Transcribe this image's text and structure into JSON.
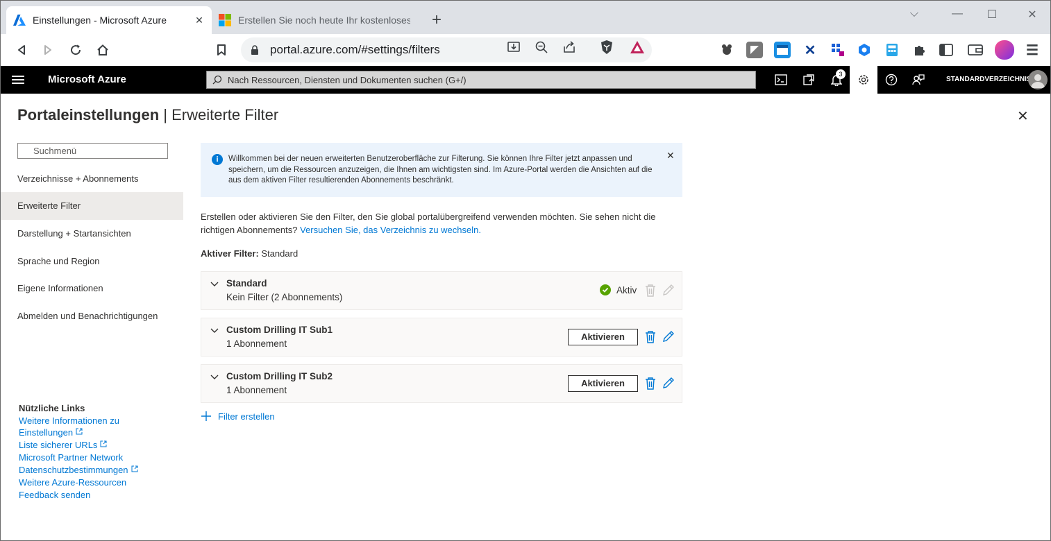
{
  "browser": {
    "tabs": [
      {
        "title": "Einstellungen - Microsoft Azure",
        "active": true
      },
      {
        "title": "Erstellen Sie noch heute Ihr kostenloses A",
        "active": false
      }
    ],
    "url": "portal.azure.com/#settings/filters"
  },
  "azure_header": {
    "brand": "Microsoft Azure",
    "search_placeholder": "Nach Ressourcen, Diensten und Dokumenten suchen (G+/)",
    "notification_count": "3",
    "directory": "STANDARDVERZEICHNIS"
  },
  "page": {
    "title_bold": "Portaleinstellungen",
    "title_separator": " | ",
    "title_rest": "Erweiterte Filter"
  },
  "nav": {
    "search_placeholder": "Suchmenü",
    "items": [
      {
        "label": "Verzeichnisse + Abonnements"
      },
      {
        "label": "Erweiterte Filter",
        "selected": true
      },
      {
        "label": "Darstellung + Startansichten"
      },
      {
        "label": "Sprache und Region"
      },
      {
        "label": "Eigene Informationen"
      },
      {
        "label": "Abmelden und Benachrichtigungen"
      }
    ]
  },
  "links": {
    "title": "Nützliche Links",
    "items": [
      "Weitere Informationen zu",
      "Einstellungen",
      "Liste sicherer URLs",
      "Microsoft Partner Network",
      "Datenschutzbestimmungen",
      "Weitere Azure-Ressourcen",
      "Feedback senden"
    ]
  },
  "info_banner": {
    "text": "Willkommen bei der neuen erweiterten Benutzeroberfläche zur Filterung. Sie können Ihre Filter jetzt anpassen und speichern, um die Ressourcen anzuzeigen, die Ihnen am wichtigsten sind. Im Azure-Portal werden die Ansichten auf die aus dem aktiven Filter resultierenden Abonnements beschränkt."
  },
  "description": {
    "text": "Erstellen oder aktivieren Sie den Filter, den Sie global portalübergreifend verwenden möchten. Sie sehen nicht die richtigen Abonnements? ",
    "link": "Versuchen Sie, das Verzeichnis zu wechseln."
  },
  "active_filter": {
    "label": "Aktiver Filter:",
    "value": " Standard"
  },
  "filters": [
    {
      "name": "Standard",
      "subtitle": "Kein Filter (2 Abonnements)",
      "status": "Aktiv"
    },
    {
      "name": "Custom Drilling IT Sub1",
      "subtitle": "1 Abonnement",
      "button": "Aktivieren"
    },
    {
      "name": "Custom Drilling IT Sub2",
      "subtitle": "1 Abonnement",
      "button": "Aktivieren"
    }
  ],
  "create_filter": "Filter erstellen",
  "colors": {
    "accent": "#0078d4",
    "success": "#57a300",
    "header_bg": "#000000",
    "selected_nav": "#edebe9",
    "info_bg": "#ebf3fc"
  }
}
